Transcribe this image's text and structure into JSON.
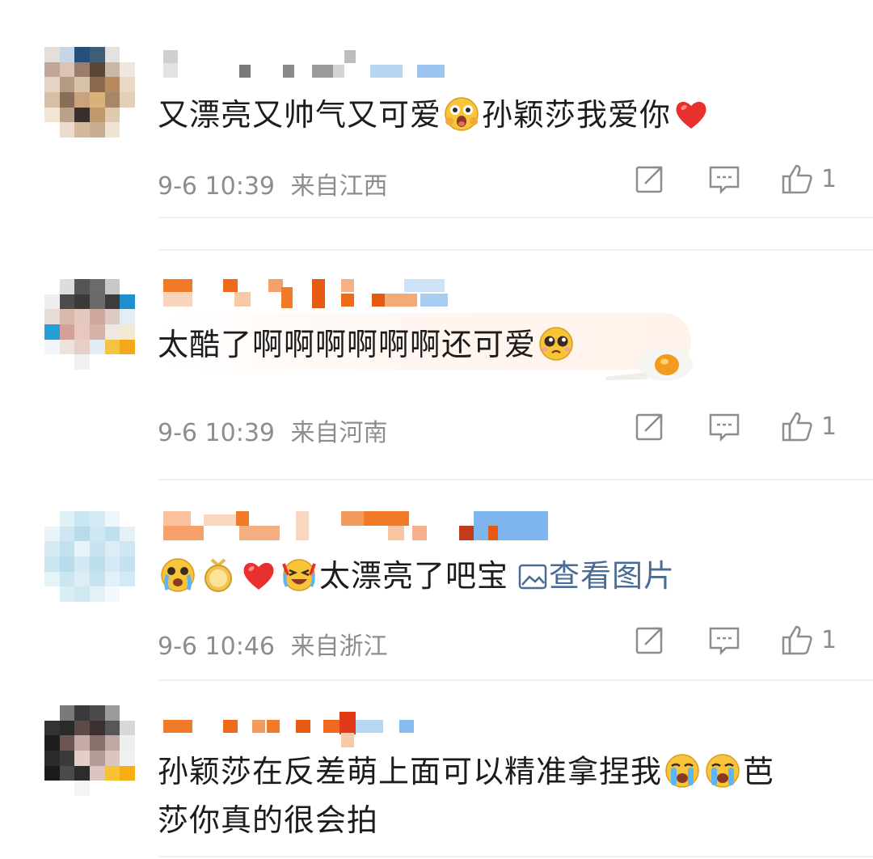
{
  "comments": [
    {
      "text_parts": [
        "又漂亮又帅气又可爱",
        "孙颖莎我爱你"
      ],
      "emojis": [
        "surprised-face-emoji",
        "red-heart-emoji"
      ],
      "time": "9-6 10:39",
      "location": "来自江西",
      "likes": "1"
    },
    {
      "text_parts": [
        "太酷了啊啊啊啊啊啊还可爱"
      ],
      "emojis": [
        "pleading-face-emoji",
        "fried-egg-decoration"
      ],
      "time": "9-6 10:39",
      "location": "来自河南",
      "likes": "1"
    },
    {
      "text_parts": [
        "太漂亮了吧宝"
      ],
      "link": "查看图片",
      "emojis": [
        "crying-face-emoji",
        "gold-medal-emoji",
        "red-heart-emoji",
        "laugh-crying-face-emoji",
        "image-icon"
      ],
      "time": "9-6 10:46",
      "location": "来自浙江",
      "likes": "1"
    },
    {
      "text_parts": [
        "孙颖莎在反差萌上面可以精准拿捏我",
        "芭",
        "莎你真的很会拍"
      ],
      "emojis": [
        "loudly-crying-face-emoji",
        "loudly-crying-face-emoji"
      ]
    }
  ],
  "icons": [
    "share-icon",
    "reply-icon",
    "like-icon"
  ],
  "colors": {
    "text": "#1c1c1c",
    "meta": "#8d8d8d",
    "link": "#4a6c94",
    "heart": "#e8312f"
  }
}
